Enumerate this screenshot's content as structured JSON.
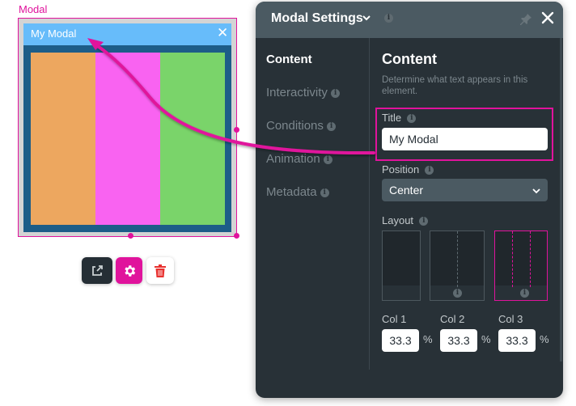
{
  "canvas": {
    "selection_label": "Modal",
    "modal": {
      "title": "My Modal",
      "close_icon": "close-icon",
      "columns": [
        {
          "name": "col1",
          "color": "#eda75f"
        },
        {
          "name": "col2",
          "color": "#f963f1"
        },
        {
          "name": "col3",
          "color": "#7ad46a"
        }
      ]
    },
    "toolbar": {
      "open_icon": "external-link-icon",
      "settings_icon": "gear-icon",
      "delete_icon": "trash-icon"
    }
  },
  "panel": {
    "title": "Modal Settings",
    "nav": [
      {
        "label": "Content",
        "active": true
      },
      {
        "label": "Interactivity",
        "info": true
      },
      {
        "label": "Conditions",
        "info": true
      },
      {
        "label": "Animation",
        "info": true
      },
      {
        "label": "Metadata",
        "info": true
      }
    ],
    "content": {
      "heading": "Content",
      "description": "Determine what text appears in this element.",
      "title_label": "Title",
      "title_value": "My Modal",
      "position_label": "Position",
      "position_value": "Center",
      "layout_label": "Layout",
      "layout_options": [
        "1 column",
        "2 columns",
        "3 columns"
      ],
      "layout_selected": "3 columns",
      "columns": [
        {
          "label": "Col 1",
          "value": "33.3",
          "unit": "%"
        },
        {
          "label": "Col 2",
          "value": "33.3",
          "unit": "%"
        },
        {
          "label": "Col 3",
          "value": "33.3",
          "unit": "%"
        }
      ]
    }
  },
  "colors": {
    "accent": "#e0139c",
    "panel_bg": "#283137",
    "panel_header": "#4b5a62",
    "modal_header": "#67bcfa",
    "modal_frame": "#1d5d88"
  }
}
